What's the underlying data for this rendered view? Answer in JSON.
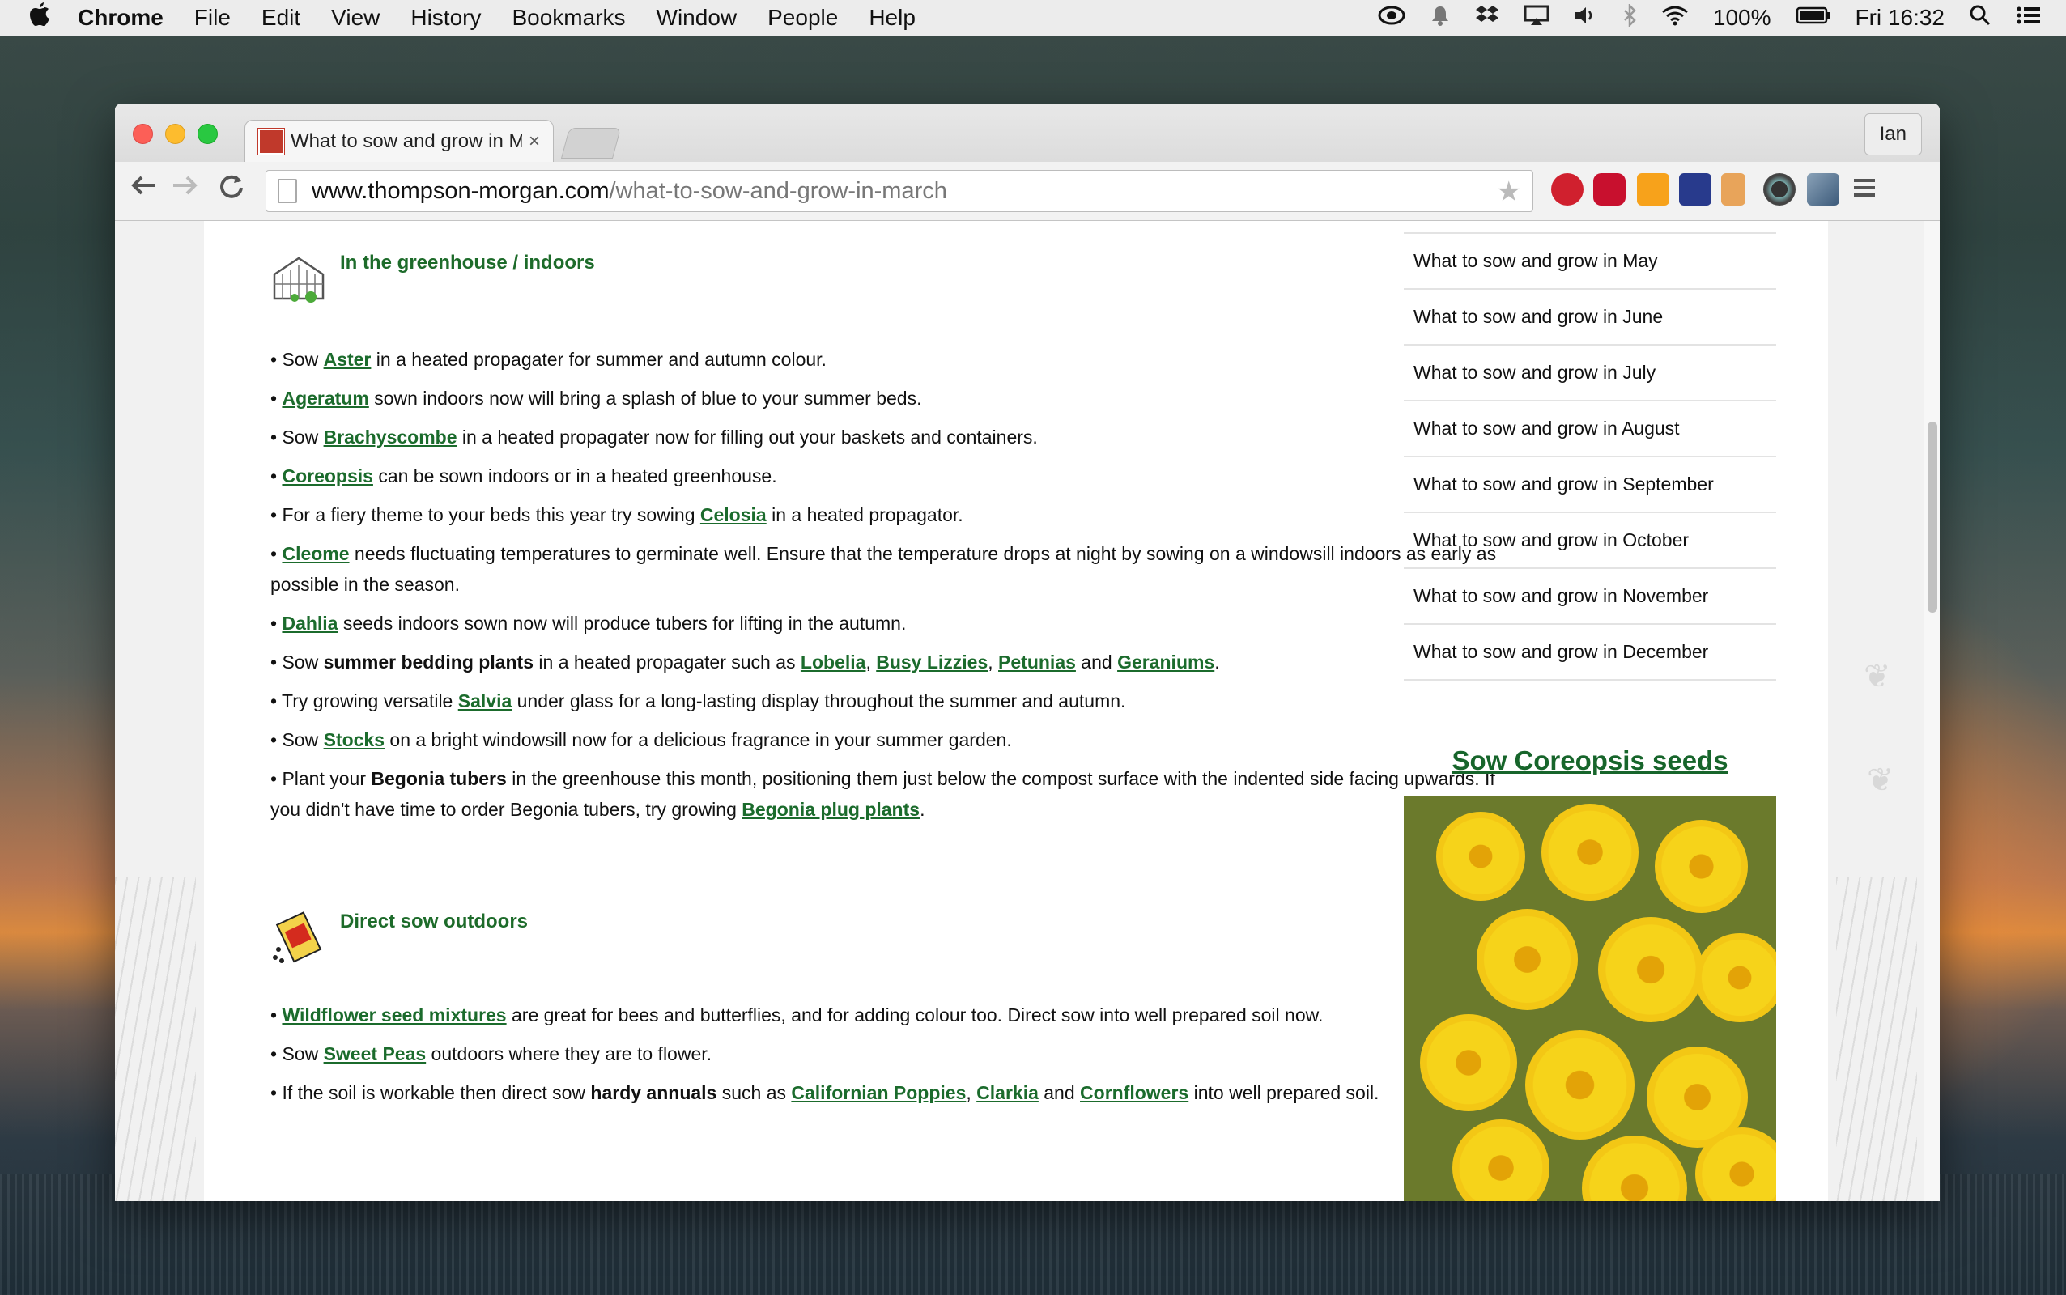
{
  "menubar": {
    "apple": "",
    "items": [
      "Chrome",
      "File",
      "Edit",
      "View",
      "History",
      "Bookmarks",
      "Window",
      "People",
      "Help"
    ],
    "battery": "100%",
    "clock": "Fri 16:32"
  },
  "browser": {
    "tab_title": "What to sow and grow in March",
    "tab_close": "×",
    "profile": "Ian",
    "url_domain": "www.thompson-morgan.com",
    "url_path": "/what-to-sow-and-grow-in-march"
  },
  "greenhouse": {
    "heading": "In the greenhouse / indoors",
    "items": [
      [
        "• Sow ",
        {
          "link": "Aster"
        },
        " in a heated propagater for summer and autumn colour."
      ],
      [
        "• ",
        {
          "link": "Ageratum"
        },
        " sown indoors now will bring a splash of blue to your summer beds."
      ],
      [
        "• Sow ",
        {
          "link": "Brachyscombe"
        },
        " in a heated propagater now for filling out your baskets and containers."
      ],
      [
        "• ",
        {
          "link": "Coreopsis"
        },
        " can be sown indoors or in a heated greenhouse."
      ],
      [
        "• For a fiery theme to your beds this year try sowing ",
        {
          "link": "Celosia"
        },
        " in a heated propagator."
      ],
      [
        "• ",
        {
          "link": "Cleome"
        },
        " needs fluctuating temperatures to germinate well. Ensure that the temperature drops at night by sowing on a windowsill indoors as early as possible in the season."
      ],
      [
        "• ",
        {
          "link": "Dahlia"
        },
        " seeds indoors sown now will produce tubers for lifting in the autumn."
      ],
      [
        "• Sow ",
        {
          "bold": "summer bedding plants"
        },
        " in a heated propagater such as ",
        {
          "link": "Lobelia"
        },
        ", ",
        {
          "link": "Busy Lizzies"
        },
        ", ",
        {
          "link": "Petunias"
        },
        " and ",
        {
          "link": "Geraniums"
        },
        "."
      ],
      [
        "• Try growing versatile ",
        {
          "link": "Salvia"
        },
        " under glass for a long-lasting display throughout the summer and autumn."
      ],
      [
        "• Sow ",
        {
          "link": "Stocks"
        },
        " on a bright windowsill now for a delicious fragrance in your summer garden."
      ],
      [
        "• Plant your ",
        {
          "bold": "Begonia tubers"
        },
        " in the greenhouse this month, positioning them just below the compost surface with the indented side facing upwards. If you didn't have time to order Begonia tubers, try growing ",
        {
          "link": "Begonia plug plants"
        },
        "."
      ]
    ]
  },
  "outdoors": {
    "heading": "Direct sow outdoors",
    "items": [
      [
        "• ",
        {
          "link": "Wildflower seed mixtures"
        },
        " are great for bees and butterflies, and for adding colour too. Direct sow into well prepared soil now."
      ],
      [
        "• Sow ",
        {
          "link": "Sweet Peas"
        },
        " outdoors where they are to flower."
      ],
      [
        "• If the soil is workable then direct sow ",
        {
          "bold": "hardy annuals"
        },
        " such as ",
        {
          "link": "Californian Poppies"
        },
        ", ",
        {
          "link": "Clarkia"
        },
        " and ",
        {
          "link": "Cornflowers"
        },
        " into well prepared soil."
      ]
    ]
  },
  "sidebar": {
    "items": [
      "What to sow and grow in May",
      "What to sow and grow in June",
      "What to sow and grow in July",
      "What to sow and grow in August",
      "What to sow and grow in September",
      "What to sow and grow in October",
      "What to sow and grow in November",
      "What to sow and grow in December"
    ],
    "promo_title": "Sow Coreopsis seeds"
  },
  "colors": {
    "link": "#1b6b2c",
    "heading": "#1d6b2a"
  }
}
